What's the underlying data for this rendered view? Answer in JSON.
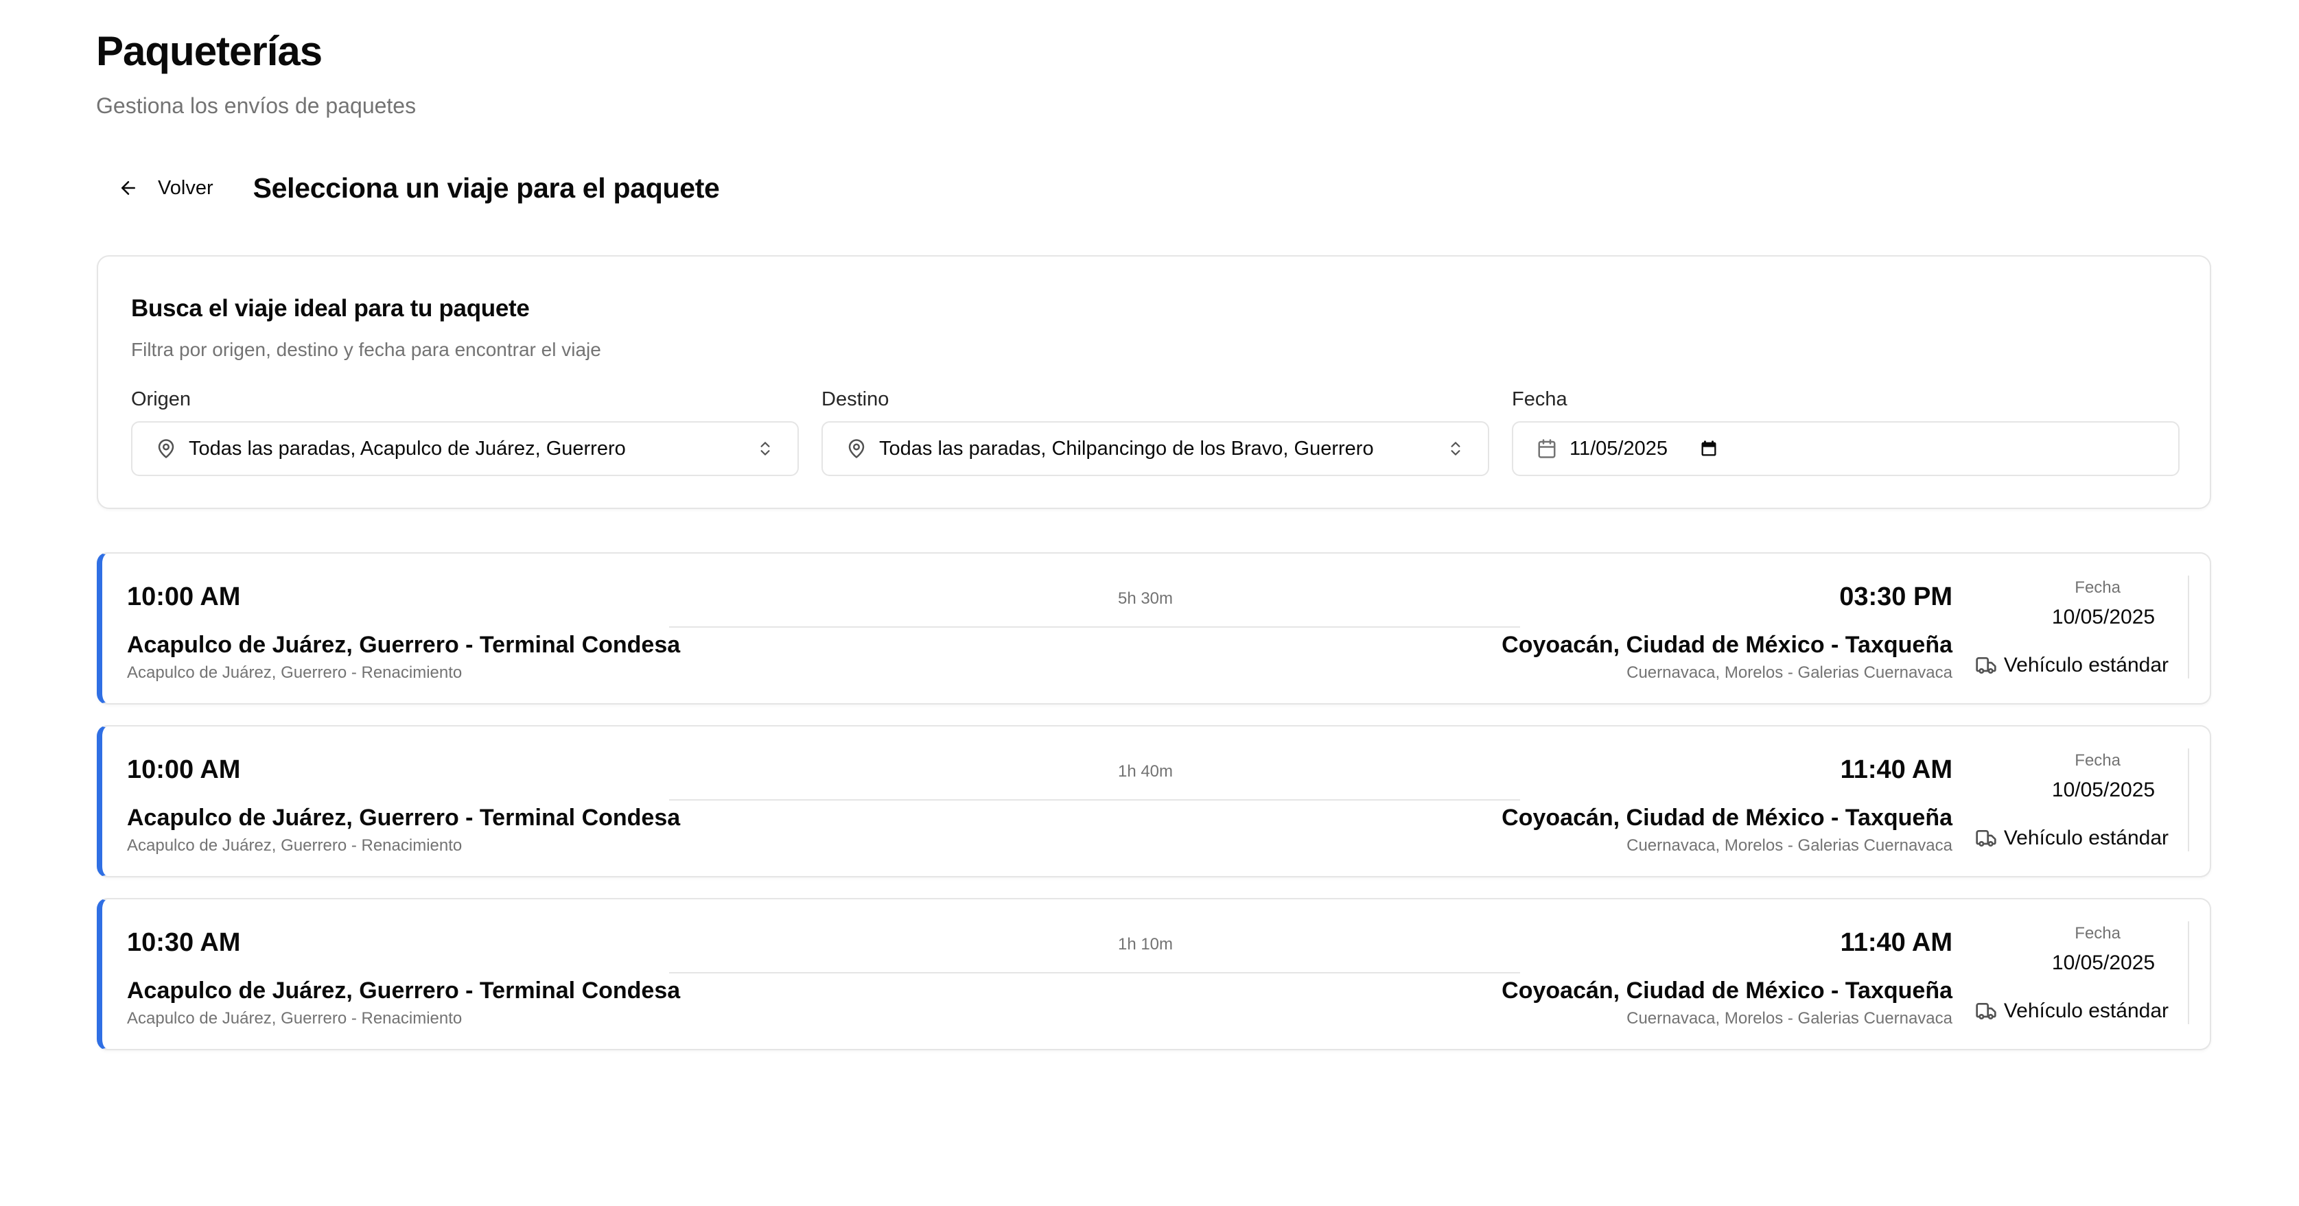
{
  "page": {
    "title": "Paqueterías",
    "subtitle": "Gestiona los envíos de paquetes"
  },
  "nav": {
    "back_label": "Volver",
    "section_title": "Selecciona un viaje para el paquete"
  },
  "filters": {
    "title": "Busca el viaje ideal para tu paquete",
    "description": "Filtra por origen, destino y fecha para encontrar el viaje",
    "origin": {
      "label": "Origen",
      "value": "Todas las paradas, Acapulco de Juárez, Guerrero",
      "icon": "map-pin-icon"
    },
    "destination": {
      "label": "Destino",
      "value": "Todas las paradas, Chilpancingo de los Bravo, Guerrero",
      "icon": "map-pin-icon"
    },
    "date": {
      "label": "Fecha",
      "value": "11/05/2025",
      "icon": "calendar-icon"
    }
  },
  "trips": [
    {
      "departure_time": "10:00 AM",
      "duration": "5h 30m",
      "arrival_time": "03:30 PM",
      "origin_name": "Acapulco de Juárez, Guerrero - Terminal Condesa",
      "origin_sub": "Acapulco de Juárez, Guerrero - Renacimiento",
      "destination_name": "Coyoacán, Ciudad de México - Taxqueña",
      "destination_sub": "Cuernavaca, Morelos - Galerias Cuernavaca",
      "date_label": "Fecha",
      "date": "10/05/2025",
      "vehicle": "Vehículo estándar"
    },
    {
      "departure_time": "10:00 AM",
      "duration": "1h 40m",
      "arrival_time": "11:40 AM",
      "origin_name": "Acapulco de Juárez, Guerrero - Terminal Condesa",
      "origin_sub": "Acapulco de Juárez, Guerrero - Renacimiento",
      "destination_name": "Coyoacán, Ciudad de México - Taxqueña",
      "destination_sub": "Cuernavaca, Morelos - Galerias Cuernavaca",
      "date_label": "Fecha",
      "date": "10/05/2025",
      "vehicle": "Vehículo estándar"
    },
    {
      "departure_time": "10:30 AM",
      "duration": "1h 10m",
      "arrival_time": "11:40 AM",
      "origin_name": "Acapulco de Juárez, Guerrero - Terminal Condesa",
      "origin_sub": "Acapulco de Juárez, Guerrero - Renacimiento",
      "destination_name": "Coyoacán, Ciudad de México - Taxqueña",
      "destination_sub": "Cuernavaca, Morelos - Galerias Cuernavaca",
      "date_label": "Fecha",
      "date": "10/05/2025",
      "vehicle": "Vehículo estándar"
    }
  ],
  "colors": {
    "accent": "#2f6fe4",
    "border": "#e5e5e5",
    "muted_text": "#737373"
  }
}
